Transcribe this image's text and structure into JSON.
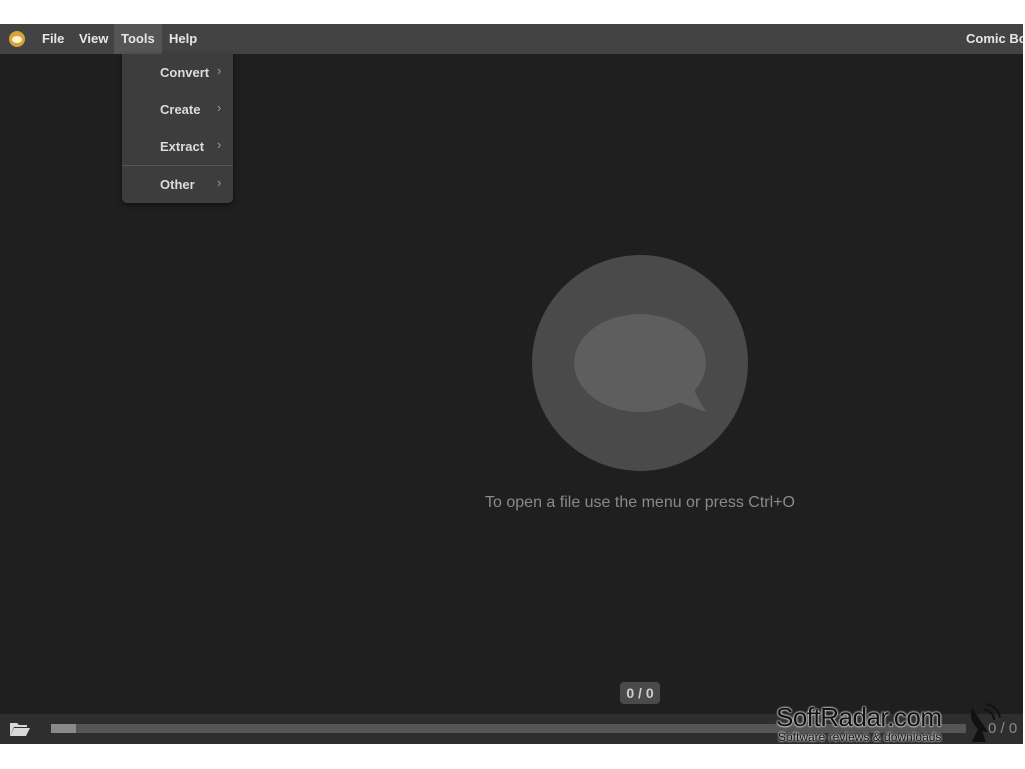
{
  "menubar": {
    "items": [
      {
        "label": "File"
      },
      {
        "label": "View"
      },
      {
        "label": "Tools"
      },
      {
        "label": "Help"
      }
    ],
    "app_title": "Comic Bo"
  },
  "tools_menu": {
    "items": [
      {
        "label": "Convert",
        "chevron": "›"
      },
      {
        "label": "Create",
        "chevron": "›"
      },
      {
        "label": "Extract",
        "chevron": "›"
      },
      {
        "label": "Other",
        "chevron": "›"
      }
    ]
  },
  "main": {
    "hint": "To open a file use the menu or press Ctrl+O",
    "page_counter": "0 / 0"
  },
  "bottombar": {
    "page_indicator": "0 / 0",
    "progress_percent": 0
  },
  "watermark": {
    "brand": "SoftRadar.com",
    "tagline": "Software reviews & downloads"
  },
  "icons": {
    "logo": "speech-bubble-icon",
    "folder": "folder-open-icon",
    "center": "speech-bubble-icon",
    "watermark": "satellite-dish-icon"
  },
  "colors": {
    "background": "#1f1f1f",
    "menubar": "#434343",
    "logo": "#d7a43c",
    "circle": "#4a4a4a"
  }
}
